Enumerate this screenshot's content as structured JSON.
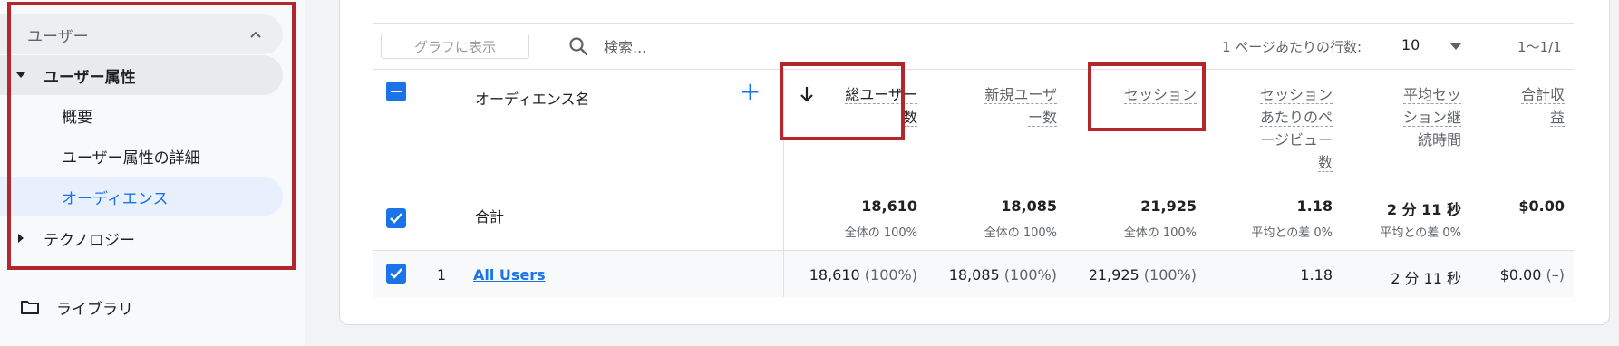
{
  "sidebar": {
    "header": "ユーザー",
    "section": "ユーザー属性",
    "items": [
      "概要",
      "ユーザー属性の詳細",
      "オーディエンス"
    ],
    "collapsed_section": "テクノロジー",
    "library": "ライブラリ"
  },
  "toolbar": {
    "graph_button": "グラフに表示",
    "search_placeholder": "検索...",
    "rows_label": "1 ページあたりの行数:",
    "rows_value": "10",
    "pagination": "1〜1/1"
  },
  "table": {
    "audience_header": "オーディエンス名",
    "columns": [
      {
        "label_lines": [
          "総ユーザー",
          "数"
        ]
      },
      {
        "label_lines": [
          "新規ユーザ",
          "ー数"
        ]
      },
      {
        "label_lines": [
          "セッション"
        ]
      },
      {
        "label_lines": [
          "セッション",
          "あたりのペ",
          "ージビュー",
          "数"
        ]
      },
      {
        "label_lines": [
          "平均セッ",
          "ション継",
          "続時間"
        ]
      },
      {
        "label_lines": [
          "合計収",
          "益"
        ]
      }
    ],
    "total_label": "合計",
    "totals": [
      {
        "value": "18,610",
        "sub": "全体の 100%"
      },
      {
        "value": "18,085",
        "sub": "全体の 100%"
      },
      {
        "value": "21,925",
        "sub": "全体の 100%"
      },
      {
        "value": "1.18",
        "sub": "平均との差 0%"
      },
      {
        "value": "2 分 11 秒",
        "sub": "平均との差 0%"
      },
      {
        "value": "$0.00",
        "sub": ""
      }
    ],
    "rows": [
      {
        "index": "1",
        "name": "All Users",
        "values": [
          {
            "main": "18,610",
            "pct": "(100%)"
          },
          {
            "main": "18,085",
            "pct": "(100%)"
          },
          {
            "main": "21,925",
            "pct": "(100%)"
          },
          {
            "main": "1.18",
            "pct": ""
          },
          {
            "main": "2 分 11 秒",
            "pct": ""
          },
          {
            "main": "$0.00",
            "pct": "(–)"
          }
        ]
      }
    ]
  },
  "colors": {
    "accent": "#1a73e8",
    "highlight": "#b3262c",
    "active_bg": "#e8f0fe"
  }
}
